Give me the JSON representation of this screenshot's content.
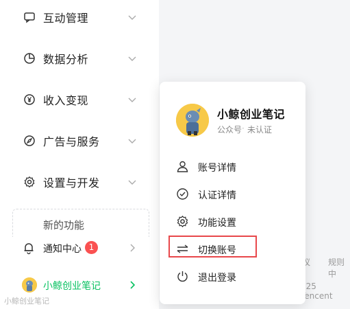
{
  "sidebar": {
    "items": [
      {
        "label": "互动管理",
        "icon": "chat-bubble-icon"
      },
      {
        "label": "数据分析",
        "icon": "pie-chart-icon"
      },
      {
        "label": "收入变现",
        "icon": "yen-circle-icon"
      },
      {
        "label": "广告与服务",
        "icon": "compass-icon"
      },
      {
        "label": "设置与开发",
        "icon": "gear-icon"
      }
    ],
    "new_feature_label": "新的功能",
    "notifications": {
      "label": "通知中心",
      "badge": "1"
    },
    "account": {
      "label": "小鲸创业笔记"
    }
  },
  "background": {
    "footer_left": "议",
    "footer_right": "规则中",
    "copyright": "025 Tencent"
  },
  "watermark": "小鲸创业笔记",
  "popup": {
    "account_name": "小鲸创业笔记",
    "account_type": "公众号",
    "separator": "·",
    "account_status": "未认证",
    "menu": [
      {
        "label": "账号详情",
        "icon": "person-icon"
      },
      {
        "label": "认证详情",
        "icon": "check-circle-icon"
      },
      {
        "label": "功能设置",
        "icon": "gear-icon"
      },
      {
        "label": "切换账号",
        "icon": "switch-arrows-icon"
      },
      {
        "label": "退出登录",
        "icon": "power-icon"
      }
    ]
  },
  "colors": {
    "accent_green": "#07c160",
    "badge_red": "#fa5151",
    "highlight_red": "#e8474a"
  }
}
